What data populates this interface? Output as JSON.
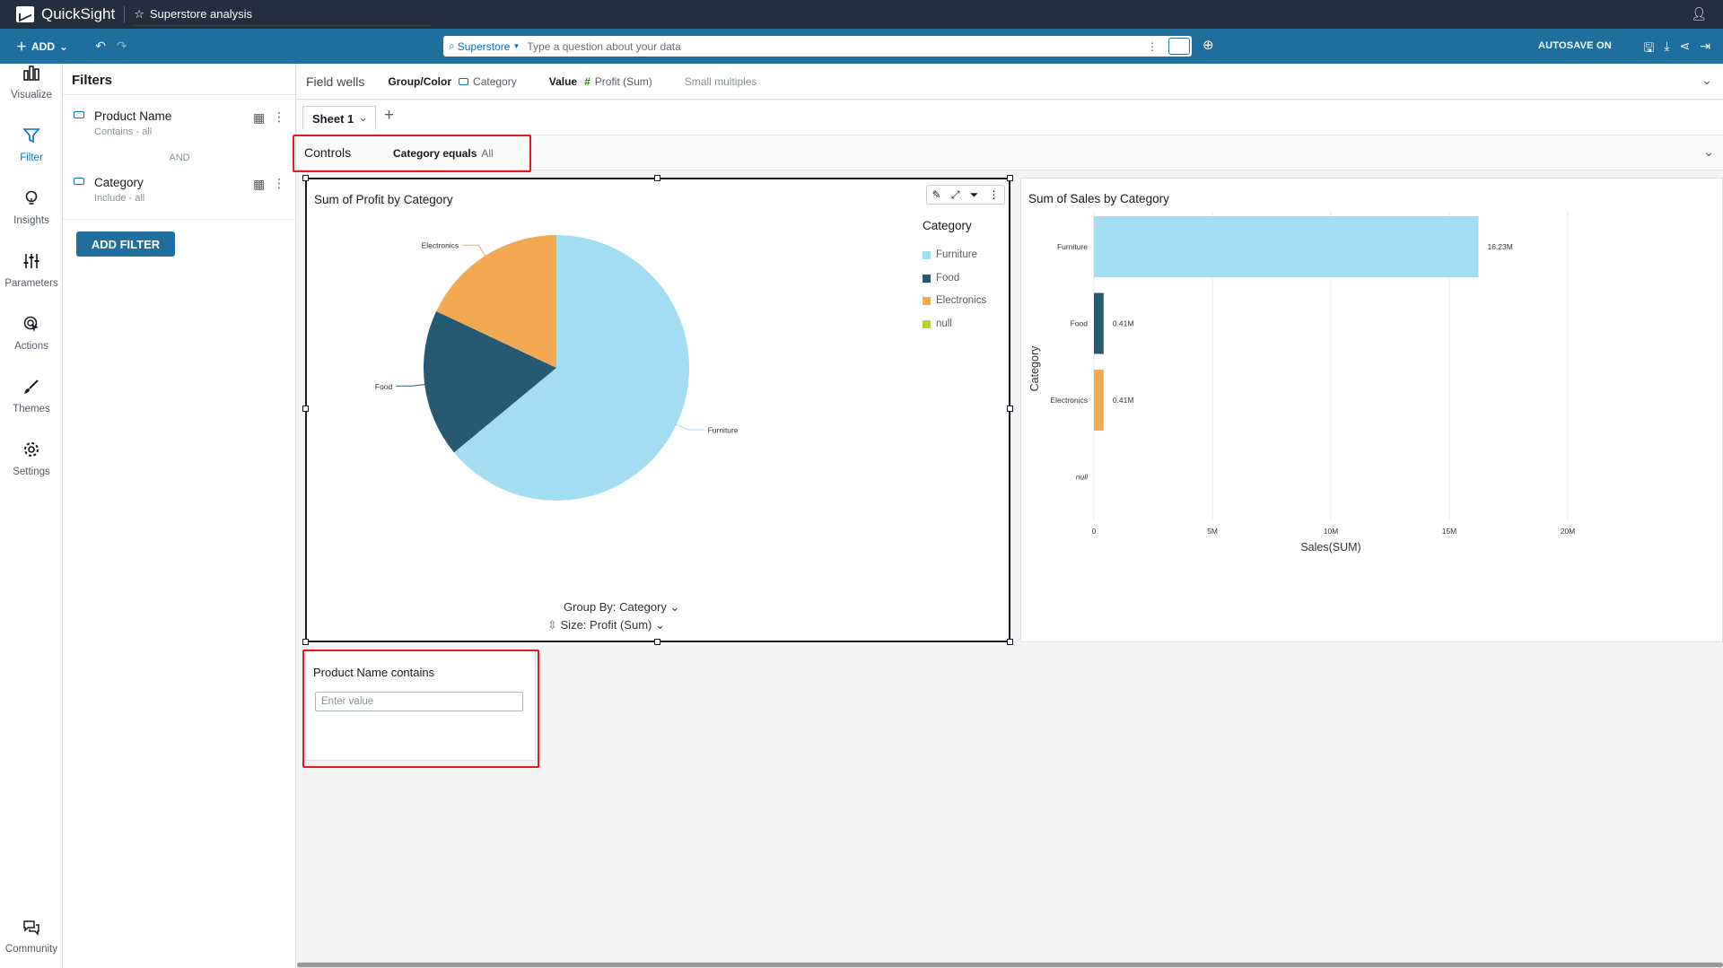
{
  "topbar": {
    "app_name": "QuickSight",
    "analysis_title": "Superstore analysis"
  },
  "toolbar": {
    "add_label": "ADD",
    "search_source": "Superstore",
    "search_placeholder": "Type a question about your data",
    "autosave": "AUTOSAVE ON"
  },
  "nav": {
    "items": [
      {
        "label": "Visualize",
        "icon": "bar-chart-icon"
      },
      {
        "label": "Filter",
        "icon": "funnel-icon"
      },
      {
        "label": "Insights",
        "icon": "lightbulb-icon"
      },
      {
        "label": "Parameters",
        "icon": "sliders-icon"
      },
      {
        "label": "Actions",
        "icon": "cursor-click-icon"
      },
      {
        "label": "Themes",
        "icon": "brush-icon"
      },
      {
        "label": "Settings",
        "icon": "gear-icon"
      }
    ],
    "community": "Community"
  },
  "filters": {
    "title": "Filters",
    "items": [
      {
        "name": "Product Name",
        "sub": "Contains - all"
      },
      {
        "name": "Category",
        "sub": "Include - all"
      }
    ],
    "and_label": "AND",
    "add_button": "ADD FILTER"
  },
  "field_wells": {
    "title": "Field wells",
    "group_label": "Group/Color",
    "group_value": "Category",
    "value_label": "Value",
    "value_value": "Profit (Sum)",
    "small_multiples": "Small multiples"
  },
  "sheet": {
    "tab_label": "Sheet 1"
  },
  "controls": {
    "title": "Controls",
    "control_label": "Category equals",
    "control_value": "All"
  },
  "pie_visual": {
    "title": "Sum of Profit by Category",
    "legend_title": "Category",
    "group_by": "Group By: Category",
    "size_by": "Size: Profit (Sum)"
  },
  "bar_visual": {
    "title": "Sum of Sales by Category",
    "y_axis_title": "Category",
    "x_axis_title": "Sales(SUM)"
  },
  "product_control": {
    "label": "Product Name contains",
    "placeholder": "Enter value"
  },
  "colors": {
    "furniture": "#a2ddf1",
    "food": "#265a73",
    "electronics": "#f3a952",
    "null": "#b5d334",
    "accent": "#1f6e9e",
    "highlight": "#e31b23"
  },
  "chart_data": [
    {
      "type": "pie",
      "title": "Sum of Profit by Category",
      "legend_title": "Category",
      "categories": [
        "Furniture",
        "Food",
        "Electronics",
        "null"
      ],
      "values": [
        64,
        18,
        18,
        0
      ],
      "unit": "percent of total (estimated)"
    },
    {
      "type": "bar",
      "orientation": "horizontal",
      "title": "Sum of Sales by Category",
      "categories": [
        "Furniture",
        "Food",
        "Electronics",
        "null"
      ],
      "values": [
        16.23,
        0.41,
        0.41,
        0
      ],
      "data_labels": [
        "16.23M",
        "0.41M",
        "0.41M",
        ""
      ],
      "xlabel": "Sales(SUM)",
      "ylabel": "Category",
      "xlim": [
        0,
        20
      ],
      "x_ticks": [
        "0",
        "5M",
        "10M",
        "15M",
        "20M"
      ],
      "grid": true
    }
  ]
}
